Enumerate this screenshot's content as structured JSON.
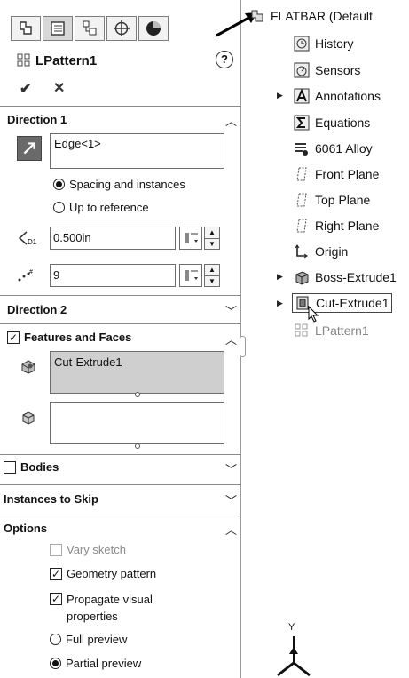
{
  "property_manager": {
    "title": "LPattern1",
    "help_glyph": "?",
    "ok_glyph": "✔",
    "cancel_glyph": "✕",
    "tabs": [
      "feature-manager-icon",
      "property-manager-icon",
      "configuration-manager-icon",
      "dimxpert-icon",
      "display-manager-icon"
    ],
    "direction1": {
      "header": "Direction 1",
      "edge_value": "Edge<1>",
      "spacing_option": "Spacing and instances",
      "reference_option": "Up to reference",
      "selected_option": "spacing",
      "spacing_value": "0.500in",
      "instances_value": "9"
    },
    "direction2": {
      "header": "Direction 2"
    },
    "features_and_faces": {
      "header": "Features and Faces",
      "checked": true,
      "features_list_item": "Cut-Extrude1"
    },
    "bodies": {
      "header": "Bodies",
      "checked": false
    },
    "instances_to_skip": {
      "header": "Instances to Skip"
    },
    "options": {
      "header": "Options",
      "vary_sketch": "Vary sketch",
      "geometry_pattern": "Geometry pattern",
      "propagate_line1": "Propagate visual",
      "propagate_line2": "properties",
      "full_preview": "Full preview",
      "partial_preview": "Partial preview"
    }
  },
  "feature_tree": {
    "root": "FLATBAR  (Default",
    "items": [
      {
        "label": "History",
        "icon": "history-icon"
      },
      {
        "label": "Sensors",
        "icon": "sensors-icon"
      },
      {
        "label": "Annotations",
        "icon": "annotations-icon"
      },
      {
        "label": "Equations",
        "icon": "equations-icon"
      },
      {
        "label": "6061 Alloy",
        "icon": "material-icon"
      },
      {
        "label": "Front Plane",
        "icon": "plane-icon"
      },
      {
        "label": "Top Plane",
        "icon": "plane-icon"
      },
      {
        "label": "Right Plane",
        "icon": "plane-icon"
      },
      {
        "label": "Origin",
        "icon": "origin-icon"
      },
      {
        "label": "Boss-Extrude1",
        "icon": "boss-extrude-icon"
      },
      {
        "label": "Cut-Extrude1",
        "icon": "cut-extrude-icon"
      },
      {
        "label": "LPattern1",
        "icon": "linear-pattern-icon"
      }
    ],
    "triad_label": "Y"
  },
  "colors": {
    "selected_list_bg": "#cfcfcf",
    "panel_border": "#9a9a9a"
  }
}
